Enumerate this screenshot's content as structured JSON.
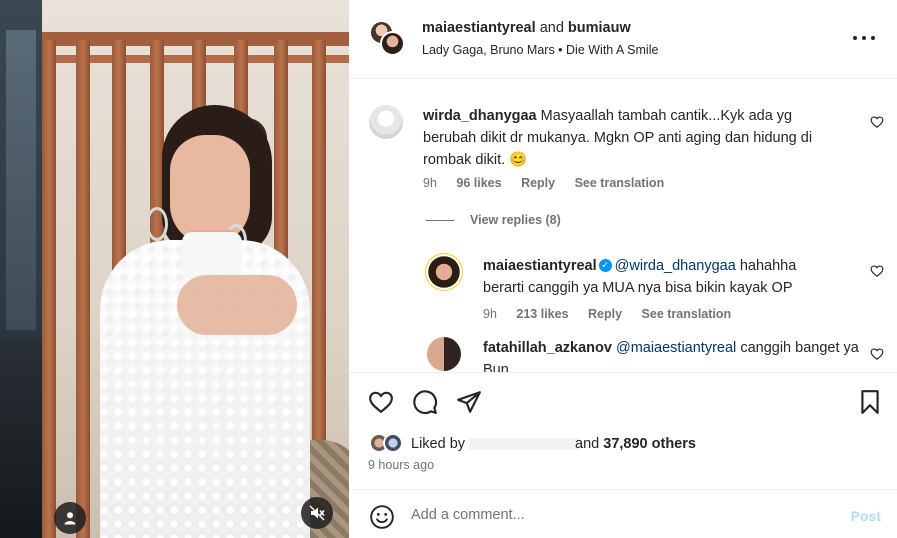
{
  "post": {
    "author_primary": "maiaestiantyreal",
    "author_join": "and",
    "author_secondary": "bumiauw",
    "audio": "Lady Gaga, Bruno Mars • Die With A Smile"
  },
  "comments": [
    {
      "username": "wirda_dhanygaa",
      "text": "Masyaallah tambah cantik...Kyk ada yg berubah dikit dr mukanya. Mgkn OP anti aging dan hidung di rombak dikit. 😊",
      "time": "9h",
      "likes": "96 likes",
      "reply": "Reply",
      "translate": "See translation",
      "view_replies": "View replies (8)"
    },
    {
      "username": "maiaestiantyreal",
      "verified": true,
      "mention": "@wirda_dhanygaa",
      "text": "hahahha berarti canggih ya MUA nya bisa bikin kayak OP",
      "time": "9h",
      "likes": "213 likes",
      "reply": "Reply",
      "translate": "See translation"
    },
    {
      "username": "fatahillah_azkanov",
      "mention": "@maiaestiantyreal",
      "text": "canggih banget ya Bun"
    }
  ],
  "likes": {
    "prefix": "Liked by",
    "suffix": "and",
    "count": "37,890 others"
  },
  "time_ago": "9 hours ago",
  "comment_input": {
    "placeholder": "Add a comment..."
  },
  "post_label": "Post",
  "icons": {
    "like": "heart-icon",
    "comment": "comment-icon",
    "share": "share-icon",
    "save": "bookmark-icon",
    "more": "more-icon",
    "emoji": "emoji-icon",
    "tag": "user-tag-icon",
    "mute": "volume-muted-icon"
  },
  "colors": {
    "link": "#00376b",
    "post_button": "#b3dbff",
    "verified": "#0095f6",
    "muted_text": "#737373"
  }
}
